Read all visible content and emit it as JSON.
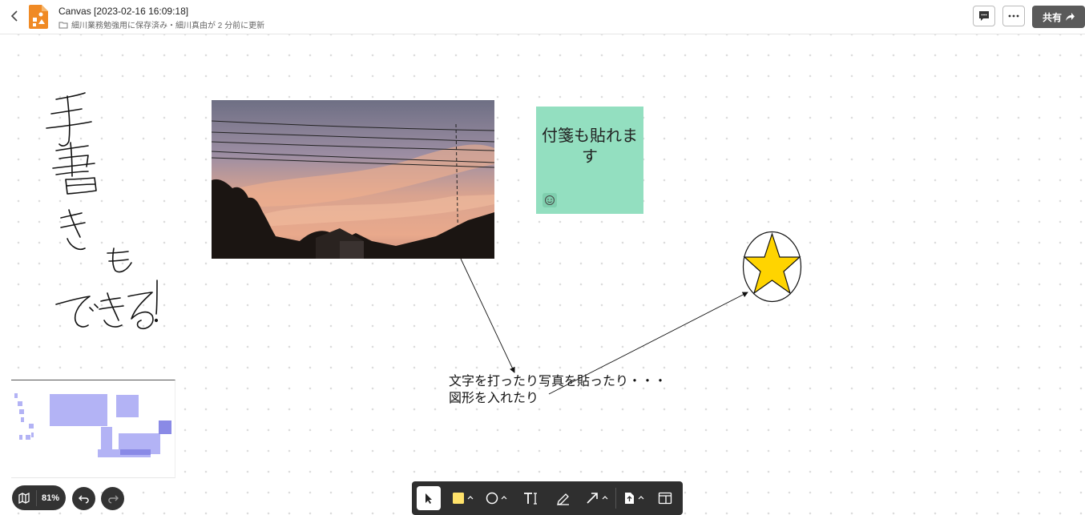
{
  "header": {
    "title": "Canvas [2023-02-16 16:09:18]",
    "subtitle": "細川業務勉強用に保存済み・細川真由が 2 分前に更新",
    "share_label": "共有"
  },
  "canvas": {
    "sticky_note_text": "付箋も貼れます",
    "text_line1": "文字を打ったり写真を貼ったり・・・",
    "text_line2": "図形を入れたり",
    "handwriting": "手書きもできる！"
  },
  "bottom": {
    "zoom_label": "81%"
  },
  "colors": {
    "sticky": "#93dfc0",
    "star_fill": "#ffd400",
    "toolbar_bg": "#2f2f2f",
    "share_bg": "#5a5a5a",
    "minimap_shape": "#b3b3f5"
  },
  "icons": {
    "back": "chevron-left-icon",
    "app": "canvas-app-icon",
    "comment": "comment-icon",
    "more": "more-icon",
    "share": "share-arrow-icon",
    "map": "map-icon",
    "undo": "undo-icon",
    "redo": "redo-icon",
    "select": "cursor-icon",
    "sticky": "sticky-note-icon",
    "shape": "circle-icon",
    "text": "text-icon",
    "pen": "pen-icon",
    "arrow": "arrow-icon",
    "upload": "upload-icon",
    "layout": "layout-icon"
  }
}
